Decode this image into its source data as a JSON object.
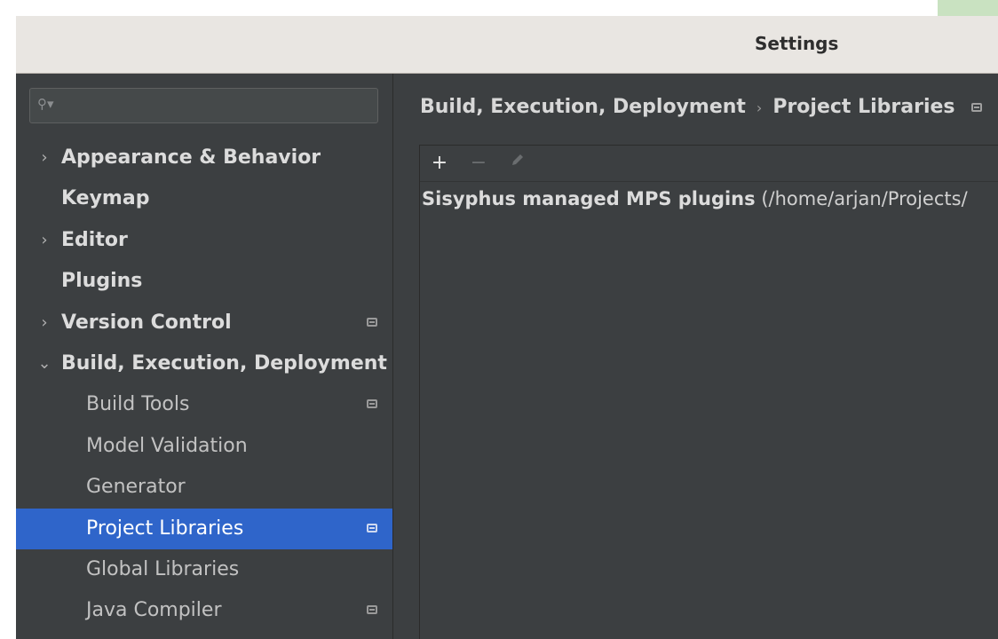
{
  "window": {
    "title": "Settings"
  },
  "search": {
    "value": "",
    "placeholder": ""
  },
  "sidebar": {
    "items": [
      {
        "label": "Appearance & Behavior",
        "arrow": "›"
      },
      {
        "label": "Keymap"
      },
      {
        "label": "Editor",
        "arrow": "›"
      },
      {
        "label": "Plugins"
      },
      {
        "label": "Version Control",
        "arrow": "›"
      },
      {
        "label": "Build, Execution, Deployment",
        "arrow": "⌄"
      },
      {
        "label": "Build Tools"
      },
      {
        "label": "Model Validation"
      },
      {
        "label": "Generator"
      },
      {
        "label": "Project Libraries"
      },
      {
        "label": "Global Libraries"
      },
      {
        "label": "Java Compiler"
      }
    ],
    "selected_index": 9,
    "selected_color": "#2f65ca"
  },
  "breadcrumb": {
    "parent": "Build, Execution, Deployment",
    "separator": "›",
    "current": "Project Libraries"
  },
  "toolbar": {
    "add_label": "+",
    "remove_label": "−",
    "edit_icon": "pencil-icon"
  },
  "libraries": [
    {
      "name": "Sisyphus managed MPS plugins",
      "path": " (/home/arjan/Projects/"
    }
  ]
}
